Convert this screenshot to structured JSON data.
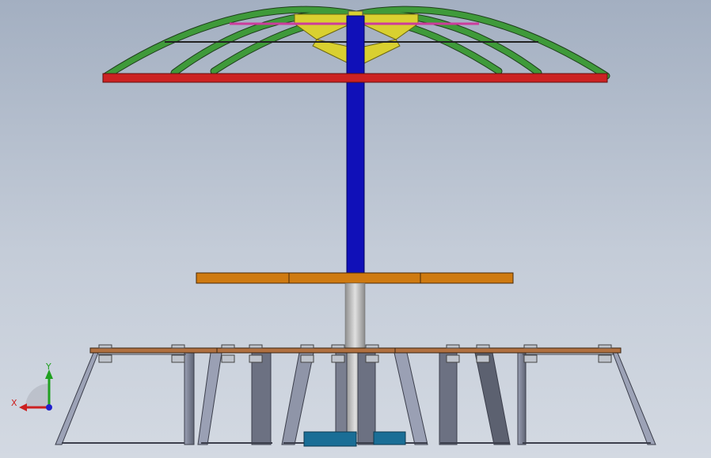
{
  "viewport": {
    "background_top": "#a3afc1",
    "background_bottom": "#d3d9e2"
  },
  "colors": {
    "canopy_ring": "#cc2222",
    "canopy_ribs": "#3f9a3a",
    "canopy_struts": "#d9d030",
    "canopy_top_bar": "#cc3c9c",
    "pole_upper": "#1010b8",
    "pole_lower": "#b8b8b8",
    "table_top": "#cf7a10",
    "bench_plank": "#b07040",
    "bench_legs": "#7a7f90",
    "base_plate": "#1a6e96"
  },
  "triad": {
    "x_label": "X",
    "y_label": "Y",
    "x_color": "#cc2020",
    "y_color": "#20a020",
    "origin_color": "#2020cc"
  }
}
